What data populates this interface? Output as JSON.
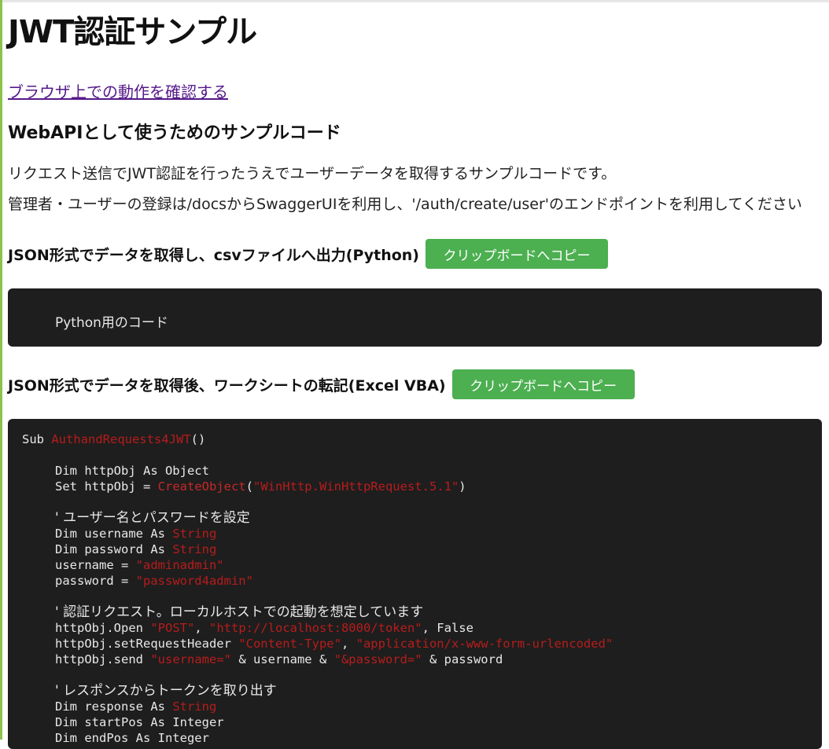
{
  "page": {
    "title": "JWT認証サンプル",
    "browser_link": "ブラウザ上での動作を確認する",
    "section_heading": "WebAPIとして使うためのサンプルコード",
    "intro1": "リクエスト送信でJWT認証を行ったうえでユーザーデータを取得するサンプルコードです。",
    "intro2": "管理者・ユーザーの登録は/docsからSwaggerUIを利用し、'/auth/create/user'のエンドポイントを利用してください"
  },
  "python_section": {
    "heading": "JSON形式でデータを取得し、csvファイルへ出力(Python)",
    "copy_button": "クリップボードへコピー",
    "code": "Python用のコード"
  },
  "vba_section": {
    "heading": "JSON形式でデータを取得後、ワークシートの転記(Excel VBA)",
    "copy_button": "クリップボードへコピー",
    "code": {
      "l1a": "Sub ",
      "l1b": "AuthandRequests4JWT",
      "l1c": "()",
      "l2a": "Dim httpObj As Object",
      "l3a": "Set httpObj = ",
      "l3b": "CreateObject",
      "l3c": "(",
      "l3d": "\"WinHttp.WinHttpRequest.5.1\"",
      "l3e": ")",
      "c1": "' ユーザー名とパスワードを設定",
      "l4a": "Dim username As ",
      "l4b": "String",
      "l5a": "Dim password As ",
      "l5b": "String",
      "l6a": "username = ",
      "l6b": "\"adminadmin\"",
      "l7a": "password = ",
      "l7b": "\"password4admin\"",
      "c2": "' 認証リクエスト。ローカルホストでの起動を想定しています",
      "l8a": "httpObj.Open ",
      "l8b": "\"POST\"",
      "l8c": ", ",
      "l8d": "\"http://localhost:8000/token\"",
      "l8e": ", False",
      "l9a": "httpObj.setRequestHeader ",
      "l9b": "\"Content-Type\"",
      "l9c": ", ",
      "l9d": "\"application/x-www-form-urlencoded\"",
      "l10a": "httpObj.send ",
      "l10b": "\"username=\"",
      "l10c": " & username & ",
      "l10d": "\"&password=\"",
      "l10e": " & password",
      "c3": "' レスポンスからトークンを取り出す",
      "l11a": "Dim response As ",
      "l11b": "String",
      "l12a": "Dim startPos As Integer",
      "l13a": "Dim endPos As Integer"
    }
  },
  "colors": {
    "accent_green": "#4caf50",
    "left_bar": "#8bc34a",
    "code_bg": "#1e1e1e",
    "string_red": "#b71c1c"
  }
}
